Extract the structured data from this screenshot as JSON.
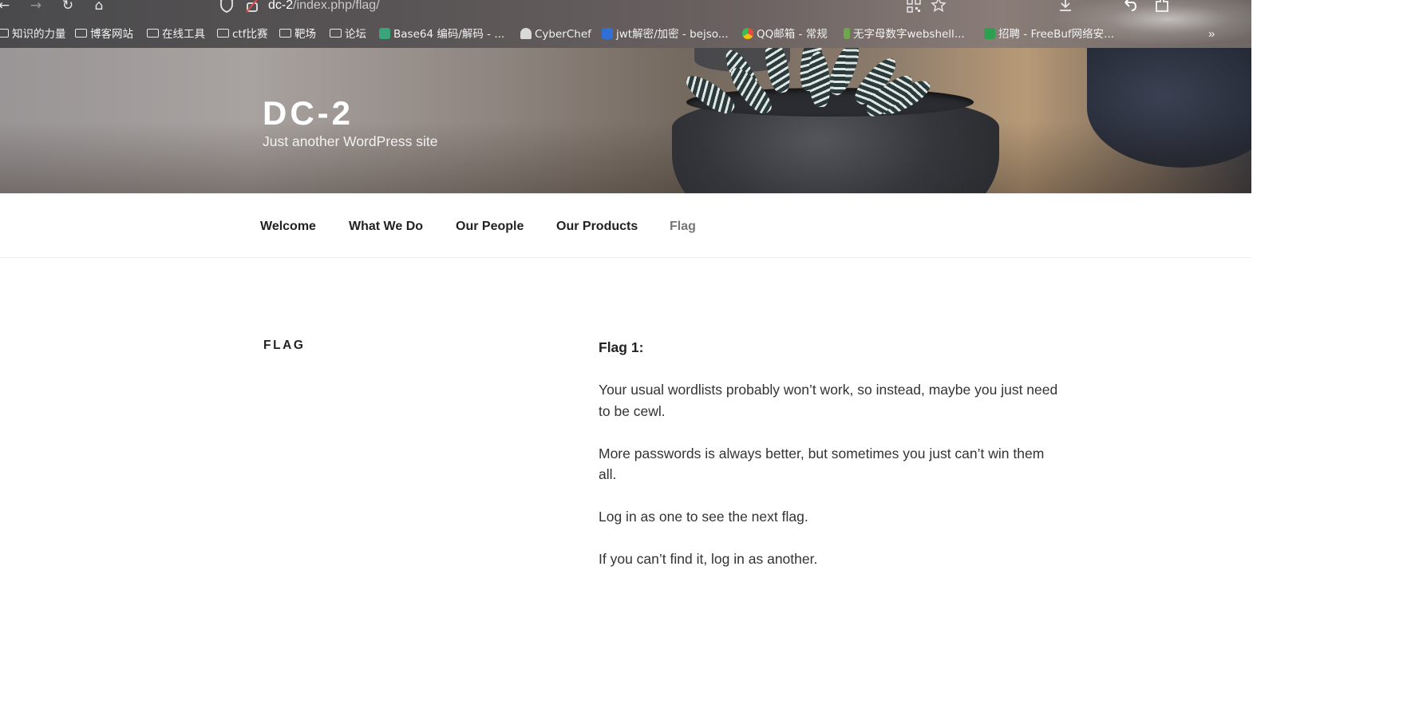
{
  "browser": {
    "url_host": "dc-2",
    "url_path": "/index.php/flag/",
    "nav": {
      "back_icon": "←",
      "forward_icon": "→",
      "reload_icon": "↻",
      "home_icon": "⌂"
    },
    "bookmarks": [
      {
        "label": "知识的力量",
        "icon": "folder-icon"
      },
      {
        "label": "博客网站",
        "icon": "folder-icon"
      },
      {
        "label": "在线工具",
        "icon": "folder-icon"
      },
      {
        "label": "ctf比赛",
        "icon": "folder-icon"
      },
      {
        "label": "靶场",
        "icon": "folder-icon"
      },
      {
        "label": "论坛",
        "icon": "folder-icon"
      },
      {
        "label": "Base64 编码/解码 - ...",
        "icon": "site-icon",
        "color": "#3aa57a"
      },
      {
        "label": "CyberChef",
        "icon": "site-icon",
        "color": "#d9d9d9"
      },
      {
        "label": "jwt解密/加密 - bejso...",
        "icon": "site-icon",
        "color": "#2f6fd6"
      },
      {
        "label": "QQ邮箱 - 常规",
        "icon": "site-icon",
        "color": "#e8a23a"
      },
      {
        "label": "无字母数字webshell...",
        "icon": "site-icon",
        "color": "#6ea84a"
      },
      {
        "label": "招聘 - FreeBuf网络安...",
        "icon": "site-icon",
        "color": "#2e9f4f"
      }
    ]
  },
  "site": {
    "title": "DC-2",
    "tagline": "Just another WordPress site"
  },
  "menu": [
    {
      "label": "Welcome",
      "current": false
    },
    {
      "label": "What We Do",
      "current": false
    },
    {
      "label": "Our People",
      "current": false
    },
    {
      "label": "Our Products",
      "current": false
    },
    {
      "label": "Flag",
      "current": true
    }
  ],
  "page": {
    "title": "FLAG",
    "paragraphs": [
      "Flag 1:",
      "Your usual wordlists probably won’t work, so instead, maybe you just need to be cewl.",
      "More passwords is always better, but sometimes you just can’t win them all.",
      "Log in as one to see the next flag.",
      "If you can’t find it, log in as another."
    ]
  },
  "colors": {
    "menu_text": "#222222",
    "menu_current": "#767676",
    "body_text": "#333333"
  }
}
